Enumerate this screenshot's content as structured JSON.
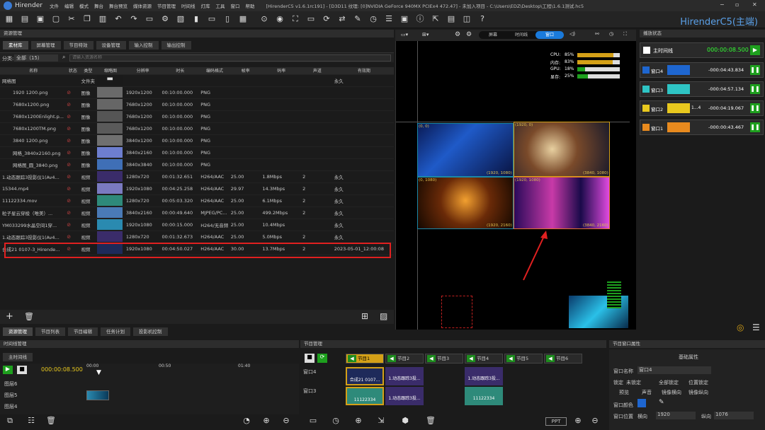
{
  "app": {
    "name": "Hirender",
    "title": "[HirenderC5 v1.6.1rc191] - [D3D11 纹理: [0]NVIDIA GeForce 940MX PCIEx4 472.47] - 未加入项目 - C:\\Users\\EDZ\\Desktop\\工程\\1.6.1测试.hc5",
    "brand": "HirenderC5(主端)"
  },
  "menu": [
    "文件",
    "编辑",
    "模式",
    "舞台",
    "舞台预览",
    "媒体资源",
    "节目管理",
    "时间线",
    "灯库",
    "工具",
    "窗口",
    "帮助"
  ],
  "resource": {
    "title": "资源管理",
    "tabs": [
      "素材库",
      "屏幕管理",
      "节目特效",
      "设备管理",
      "输入控制",
      "输出控制"
    ],
    "category_label": "分类:",
    "category_value": "全部（15）",
    "search_placeholder": "请输入资源名称",
    "columns": [
      "名称",
      "状态",
      "类型",
      "缩略图",
      "分辨率",
      "时长",
      "编码格式",
      "帧率",
      "码率",
      "声道",
      "有效期"
    ],
    "folder": {
      "name": "网格图",
      "type": "文件夹",
      "expiry": "永久"
    },
    "rows": [
      {
        "name": "1920 1200.png",
        "type": "图像",
        "res": "1920x1200",
        "dur": "00:10:00.000",
        "codec": "PNG",
        "fps": "",
        "rate": "",
        "ch": "",
        "exp": "",
        "c": "#6a6a6a"
      },
      {
        "name": "7680x1200.png",
        "type": "图像",
        "res": "7680x1200",
        "dur": "00:10:00.000",
        "codec": "PNG",
        "fps": "",
        "rate": "",
        "ch": "",
        "exp": "",
        "c": "#666"
      },
      {
        "name": "7680x1200Enlight.p...",
        "type": "图像",
        "res": "7680x1200",
        "dur": "00:10:00.000",
        "codec": "PNG",
        "fps": "",
        "rate": "",
        "ch": "",
        "exp": "",
        "c": "#555"
      },
      {
        "name": "7680x1200TM.png",
        "type": "图像",
        "res": "7680x1200",
        "dur": "00:10:00.000",
        "codec": "PNG",
        "fps": "",
        "rate": "",
        "ch": "",
        "exp": "",
        "c": "#5a5a5a"
      },
      {
        "name": "3840 1200.png",
        "type": "图像",
        "res": "3840x1200",
        "dur": "00:10:00.000",
        "codec": "PNG",
        "fps": "",
        "rate": "",
        "ch": "",
        "exp": "",
        "c": "#707070"
      },
      {
        "name": "网格_3840x2160.png",
        "type": "图像",
        "res": "3840x2160",
        "dur": "00:10:00.000",
        "codec": "PNG",
        "fps": "",
        "rate": "",
        "ch": "",
        "exp": "",
        "c": "#6d7ecf"
      },
      {
        "name": "网格图_圆_3840.png",
        "type": "图像",
        "res": "3840x3840",
        "dur": "00:10:00.000",
        "codec": "PNG",
        "fps": "",
        "rate": "",
        "ch": "",
        "exp": "",
        "c": "#3f6fb6"
      },
      {
        "name": "1.动态跟踪3投影仪1(Av4...",
        "type": "视频",
        "res": "1280x720",
        "dur": "00:01:32.651",
        "codec": "H264/AAC",
        "fps": "25.00",
        "rate": "1.8Mbps",
        "ch": "2",
        "exp": "永久",
        "c": "#3a2c6a"
      },
      {
        "name": "15344.mp4",
        "type": "视频",
        "res": "1920x1080",
        "dur": "00:04:25.258",
        "codec": "H264/AAC",
        "fps": "29.97",
        "rate": "14.3Mbps",
        "ch": "2",
        "exp": "永久",
        "c": "#7a7ac0"
      },
      {
        "name": "11122334.mov",
        "type": "视频",
        "res": "1280x720",
        "dur": "00:05:03.320",
        "codec": "H264/AAC",
        "fps": "25.00",
        "rate": "6.1Mbps",
        "ch": "2",
        "exp": "永久",
        "c": "#2e8a7a"
      },
      {
        "name": "粒子星云穿梭（唯美）...",
        "type": "视频",
        "res": "3840x2160",
        "dur": "00:00:49.640",
        "codec": "MJPEG/PC...",
        "fps": "25.00",
        "rate": "499.2Mbps",
        "ch": "2",
        "exp": "永久",
        "c": "#4a7ab6"
      },
      {
        "name": "YM033299水晶空间1穿...",
        "type": "视频",
        "res": "1920x1080",
        "dur": "00:00:15.000",
        "codec": "H264/无音频",
        "fps": "25.00",
        "rate": "10.4Mbps",
        "ch": "",
        "exp": "永久",
        "c": "#2a8ab0"
      },
      {
        "name": "1.动态跟踪3投影仪1(Av4...",
        "type": "视频",
        "res": "1280x720",
        "dur": "00:01:32.673",
        "codec": "H264/AAC",
        "fps": "25.00",
        "rate": "5.0Mbps",
        "ch": "2",
        "exp": "永久",
        "c": "#3a2c6a"
      },
      {
        "name": "合成21 0107-3_Hirende...",
        "type": "视频",
        "res": "1920x1080",
        "dur": "00:04:50.027",
        "codec": "H264/AAC",
        "fps": "30.00",
        "rate": "13.7Mbps",
        "ch": "2",
        "exp": "2023-05-01_12:00:08",
        "c": "#1e2a5a"
      }
    ]
  },
  "bottomtabs": [
    "资源管理",
    "节目列表",
    "节目编辑",
    "任务计划",
    "投影机控制"
  ],
  "preview": {
    "seg": [
      "屏幕",
      "时间线",
      "窗口"
    ],
    "stats": [
      {
        "k": "CPU:",
        "v": "85%",
        "p": 0.85,
        "c": "#d4a017"
      },
      {
        "k": "内存:",
        "v": "83%",
        "p": 0.83,
        "c": "#d4a017"
      },
      {
        "k": "GPU:",
        "v": "18%",
        "p": 0.18,
        "c": "#1ea01e"
      },
      {
        "k": "显存:",
        "v": "25%",
        "p": 0.25,
        "c": "#1ea01e"
      }
    ],
    "labels": [
      "(1920, 1080)",
      "(3840, 1080)",
      "(1920, 2160)",
      "(3840, 2160)",
      "(0, 0)",
      "(1920, 0)",
      "(0, 1080)",
      "(1920, 1080)"
    ]
  },
  "playstate": {
    "title": "播放状态",
    "main": {
      "name": "主时间线",
      "time": "000:00:08.500"
    },
    "items": [
      {
        "name": "窗口4",
        "time": "-000:04:43.834",
        "c": "#1e66d0"
      },
      {
        "name": "窗口3",
        "time": "-000:04:57.134",
        "c": "#2ec4c4"
      },
      {
        "name": "窗口2",
        "time": "-000:04:19.067",
        "c": "#e8c81e",
        "extra": "1...4"
      },
      {
        "name": "窗口1",
        "time": "-000:00:43.467",
        "c": "#e88a1e"
      }
    ]
  },
  "timeline": {
    "title": "时间线管理",
    "tab": "主时间线",
    "time": "000:00:08.500",
    "ticks": [
      "00:00",
      "00:50",
      "01:40"
    ],
    "layers": [
      "图层6",
      "图层5",
      "图层4"
    ]
  },
  "program": {
    "title": "节目管理",
    "channels": [
      "节目1",
      "节目2",
      "节目3",
      "节目4",
      "节目5",
      "节目6"
    ],
    "windows": [
      "窗口4",
      "窗口3"
    ],
    "clips4": [
      "合成21 0107...",
      "1.动态跟踪3投...",
      "1.动态跟踪3投..."
    ],
    "clips3": [
      "11122334",
      "1.动态跟踪3投...",
      "11122334"
    ],
    "ppt": "PPT"
  },
  "props": {
    "title": "节目窗口属性",
    "section": "基础属性",
    "name_label": "窗口名称",
    "name_value": "窗口4",
    "lock_label": "锁定",
    "locks": [
      "未锁定",
      "全部锁定",
      "位置锁定"
    ],
    "opts": [
      "预览",
      "声音",
      "镜像横向",
      "镜像纵向"
    ],
    "color_label": "窗口颜色",
    "pos_label": "窗口位置",
    "x_label": "横向",
    "x_value": "1920",
    "y_label": "纵向",
    "y_value": "1076"
  }
}
